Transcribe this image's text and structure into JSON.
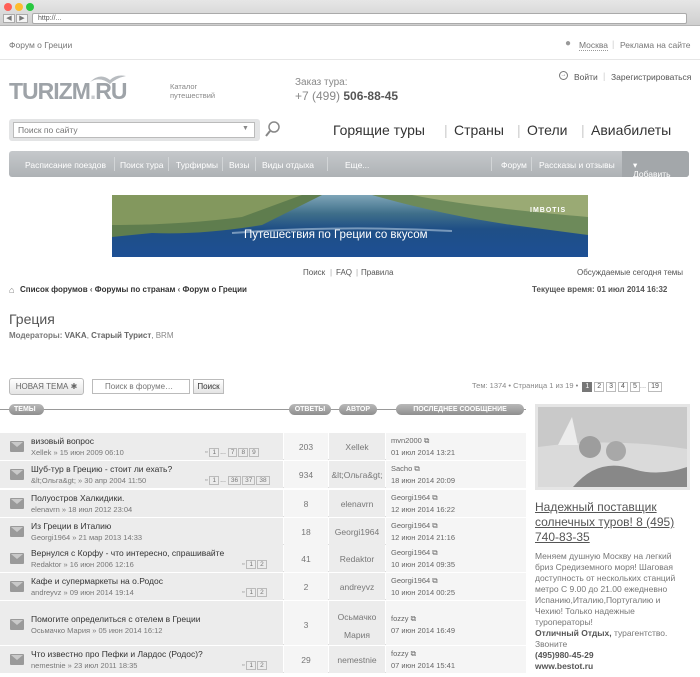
{
  "browser": {
    "url": "http://..."
  },
  "topbar": {
    "forum_link": "Форум о Греции",
    "city": "Москва",
    "ads": "Реклама на сайте"
  },
  "logo": {
    "text": "TURIZM",
    "suffix": "RU",
    "tagline1": "Каталог",
    "tagline2": "путешествий"
  },
  "order": {
    "label": "Заказ тура:",
    "phone_prefix": "+7 (499)",
    "phone_number": "506-88-45"
  },
  "auth": {
    "login": "Войти",
    "register": "Зарегистрироваться"
  },
  "search": {
    "placeholder": "Поиск по сайту"
  },
  "main_nav": [
    "Горящие туры",
    "Страны",
    "Отели",
    "Авиабилеты"
  ],
  "menu": {
    "items": [
      "Расписание поездов",
      "Поиск тура",
      "Турфирмы",
      "Визы",
      "Виды отдыха",
      "Еще..."
    ],
    "right": [
      "Форум",
      "Рассказы и отзывы"
    ],
    "add": "Добавить"
  },
  "banner": {
    "text": "Путешествия по Греции со вкусом",
    "brand": "IMBOTIS"
  },
  "forum_links": {
    "search": "Поиск",
    "faq": "FAQ",
    "rules": "Правила",
    "today": "Обсуждаемые сегодня темы"
  },
  "breadcrumb": {
    "items": [
      "Список форумов",
      "Форумы по странам",
      "Форум о Греции"
    ],
    "time": "Текущее время: 01 июл 2014 16:32"
  },
  "forum": {
    "title": "Греция",
    "moderators_label": "Модераторы:",
    "moderators": [
      "VAKA",
      "Старый Турист",
      "BRM"
    ]
  },
  "toolbar": {
    "new_topic": "НОВАЯ ТЕМА",
    "search_placeholder": "Поиск в форуме…",
    "search_button": "Поиск",
    "stats": "Тем: 1374 • Страница 1 из 19 •",
    "pages": [
      "1",
      "2",
      "3",
      "4",
      "5",
      "...",
      "19"
    ]
  },
  "columns": {
    "topics": "ТЕМЫ",
    "replies": "ОТВЕТЫ",
    "author": "АВТОР",
    "last": "ПОСЛЕДНЕЕ СООБЩЕНИЕ"
  },
  "topics": [
    {
      "title": "визовый вопрос",
      "meta": "Xellek » 15 июн 2009 06:10",
      "pages": [
        "1",
        "...",
        "7",
        "8",
        "9"
      ],
      "replies": "203",
      "author": "Xellek",
      "last_user": "mvn2000",
      "last_date": "01 июл 2014 13:21"
    },
    {
      "title": "Шуб-тур в Грецию - стоит ли ехать?",
      "meta": "&lt;Ольга&gt; » 30 апр 2004 11:50",
      "pages": [
        "1",
        "...",
        "36",
        "37",
        "38"
      ],
      "replies": "934",
      "author": "&lt;Ольга&gt;",
      "last_user": "Sacho",
      "last_date": "18 июн 2014 20:09"
    },
    {
      "title": "Полуостров Халкидики.",
      "meta": "elenavrn » 18 июл 2012 23:04",
      "pages": [],
      "replies": "8",
      "author": "elenavrn",
      "last_user": "Georgi1964",
      "last_date": "12 июн 2014 16:22"
    },
    {
      "title": "Из Греции в Италию",
      "meta": "Georgi1964 » 21 мар 2013 14:33",
      "pages": [],
      "replies": "18",
      "author": "Georgi1964",
      "last_user": "Georgi1964",
      "last_date": "12 июн 2014 21:16"
    },
    {
      "title": "Вернулся с Корфу - что интересно, спрашивайте",
      "meta": "Redaktor » 16 июн 2006 12:16",
      "pages": [
        "1",
        "2"
      ],
      "replies": "41",
      "author": "Redaktor",
      "last_user": "Georgi1964",
      "last_date": "10 июн 2014 09:35"
    },
    {
      "title": "Кафе и супермаркеты на о.Родос",
      "meta": "andreyvz » 09 июн 2014 19:14",
      "pages": [
        "1",
        "2"
      ],
      "replies": "2",
      "author": "andreyvz",
      "last_user": "Georgi1964",
      "last_date": "10 июн 2014 00:25"
    },
    {
      "title": "Помогите определиться с отелем в Греции",
      "meta": "Осьмачко Мария » 05 июн 2014 16:12",
      "pages": [],
      "replies": "3",
      "author": "Осьмачко Мария",
      "last_user": "fozzy",
      "last_date": "07 июн 2014 16:49"
    },
    {
      "title": "Что известно про Пефки и Лардос (Родос)?",
      "meta": "nemestnie » 23 июл 2011 18:35",
      "pages": [
        "1",
        "2"
      ],
      "replies": "29",
      "author": "nemestnie",
      "last_user": "fozzy",
      "last_date": "07 июн 2014 15:41"
    }
  ],
  "ad": {
    "headline": "Надежный поставщик солнечных туров! 8 (495) 740-83-35",
    "body": "Меняем душную Москву на легкий бриз Средиземного моря! Шаговая доступность от нескольких станций метро С 9.00 до 21.00 ежедневно Испанию,Италию,Португалию и Чехию! Только надежные туроператоры!",
    "company": "Отличный Отдых,",
    "company_suffix": " турагентство. Звоните",
    "phone": "(495)980-45-29",
    "site": "www.bestot.ru"
  }
}
